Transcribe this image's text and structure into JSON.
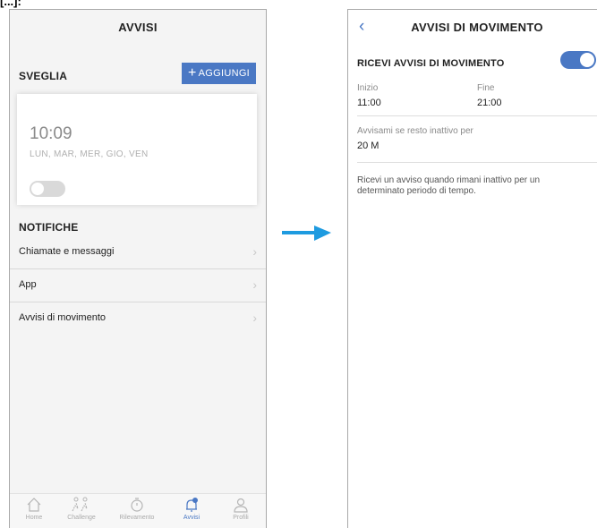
{
  "screen_label": "[...]:",
  "left": {
    "title": "AVVISI",
    "alarm": {
      "section_title": "SVEGLIA",
      "add_label": "AGGIUNGI",
      "time": "10:09",
      "days": "LUN, MAR, MER, GIO, VEN",
      "toggle_on": false
    },
    "notifications": {
      "section_title": "NOTIFICHE",
      "items": [
        {
          "label": "Chiamate e messaggi"
        },
        {
          "label": "App"
        },
        {
          "label": "Avvisi di movimento"
        }
      ]
    },
    "tab_bar": {
      "tabs": [
        {
          "label": "Home",
          "icon": "home-icon"
        },
        {
          "label": "Challenge",
          "icon": "runners-icon"
        },
        {
          "label": "Rilevamento",
          "icon": "stopwatch-icon"
        },
        {
          "label": "Avvisi",
          "icon": "bell-gear-icon",
          "active": true
        },
        {
          "label": "Profili",
          "icon": "person-icon"
        }
      ]
    }
  },
  "transition_arrow": {
    "icon": "right-arrow-icon",
    "color": "#1e9be0"
  },
  "right": {
    "title": "AVVISI DI MOVIMENTO",
    "back_icon": "chevron-left-icon",
    "receive_label": "RICEVI AVVISI DI MOVIMENTO",
    "toggle_on": true,
    "start_label": "Inizio",
    "start_value": "11:00",
    "end_label": "Fine",
    "end_value": "21:00",
    "inactive_label": "Avvisami se resto inattivo per",
    "inactive_value": "20 M",
    "description": "Ricevi un avviso quando rimani inattivo per un determinato periodo di tempo."
  },
  "colors": {
    "accent": "#4a78c4",
    "arrow": "#1e9be0",
    "screen_bg": "#f4f4f4"
  }
}
